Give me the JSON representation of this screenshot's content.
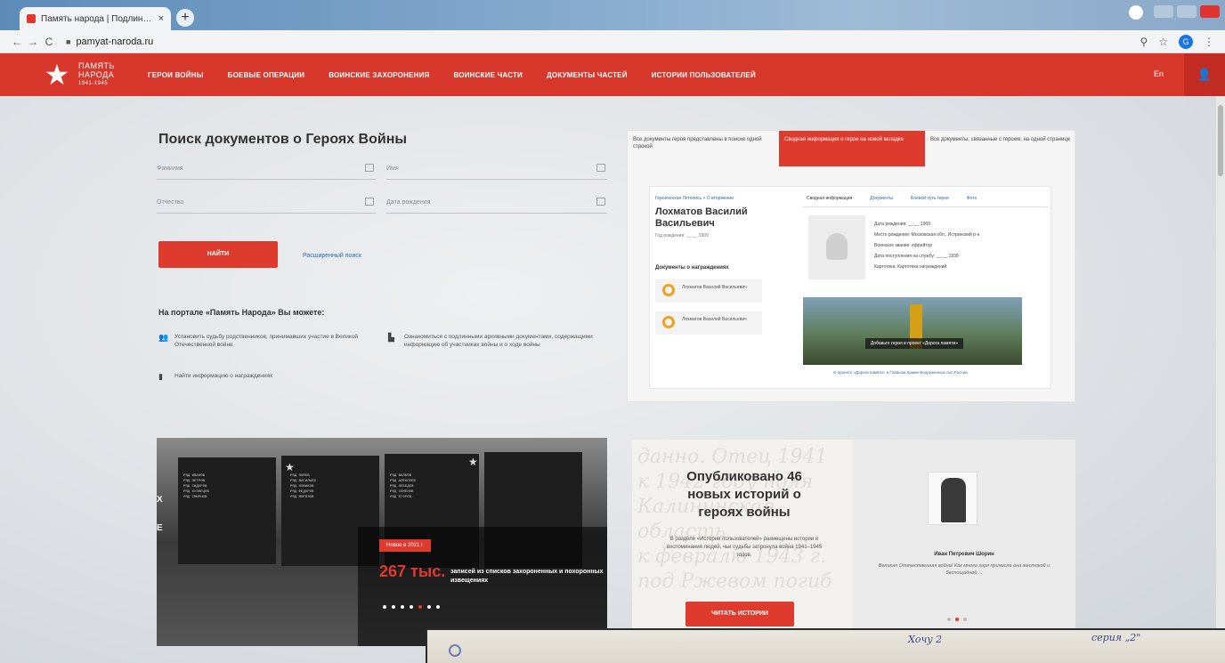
{
  "browser": {
    "tab_title": "Память народа | Подлинные до",
    "tab_close": "×",
    "new_tab": "+",
    "url": "pamyat-naroda.ru",
    "account_initial": "G"
  },
  "site": {
    "logo_line1": "ПАМЯТЬ",
    "logo_line2": "НАРОДА",
    "logo_years": "1941-1945",
    "nav": [
      "ГЕРОИ ВОЙНЫ",
      "БОЕВЫЕ ОПЕРАЦИИ",
      "ВОИНСКИЕ ЗАХОРОНЕНИЯ",
      "ВОИНСКИЕ ЧАСТИ",
      "ДОКУМЕНТЫ ЧАСТЕЙ",
      "ИСТОРИИ ПОЛЬЗОВАТЕЛЕЙ"
    ],
    "lang": "En"
  },
  "search": {
    "title": "Поиск документов о Героях Войны",
    "surname": "Фамилия",
    "name": "Имя",
    "patronymic": "Отчество",
    "birthdate": "Дата рождения",
    "find_button": "НАЙТИ",
    "advanced_link": "Расширенный поиск"
  },
  "portal": {
    "title": "На портале «Память Народа» Вы можете:",
    "features": [
      "Установить судьбу родственников, принимавших участие в Великой Отечественной войне",
      "Ознакомиться с подлинными архивными документами, содержащими информацию об участниках войны и о ходе войны",
      "Найти информацию о награждениях"
    ]
  },
  "preview": {
    "tabs": [
      "Все документы героя представлены в поиске одной строкой",
      "Сводная информация о герое на новой вкладке",
      "Все документы, связанные с героем, на одной странице"
    ],
    "breadcrumb": "Героическая Летопись > О вторжении",
    "hero_name": "Лохматов Василий Васильевич",
    "born": "Год рождения: __.__.1909",
    "section": "Документы о награждениях",
    "medal1": "Лохматов Василий Васильевич",
    "medal2": "Лохматов Василий Васильевич",
    "right_tabs": [
      "Сводная информация",
      "Документы",
      "Боевой путь героя",
      "Фото"
    ],
    "info_rows": [
      "Дата рождения: __.__.1909",
      "Место рождения: Московская обл., Истринский р-н",
      "Воинское звание: ефрейтор",
      "Дата поступления на службу: __.__.1939",
      "Картотека: Картотека награждений"
    ],
    "banner_caption": "Добавьте героя в проект «Дорога памяти»",
    "banner_link": "О проекте «Дорога памяти» в Главном Храме Вооруженных сил России"
  },
  "hero_banner": {
    "badge": "Новое в 2021 г.",
    "count": "267 тыс.",
    "text": "записей из списков захороненных и похоронных извещениях",
    "side_chars": [
      "Х",
      "Е"
    ]
  },
  "stories": {
    "heading": "Опубликовано 46 новых историй о героях войны",
    "desc": "В разделе «Истории пользователей» размещены истории и воспоминания людей, чьи судьбы затронула война 1941–1945 годов.",
    "button": "ЧИТАТЬ ИСТОРИИ",
    "person_name": "Иван Петрович Шорин",
    "person_desc": "Великая Отечественная война! Как много горя принесла она жестокой и беспощадной ..."
  },
  "document": {
    "handwriting1": "Хочу 2",
    "handwriting2": "серия „2\""
  },
  "colors": {
    "brand_red": "#d8372c",
    "button_red": "#de3a2e"
  }
}
